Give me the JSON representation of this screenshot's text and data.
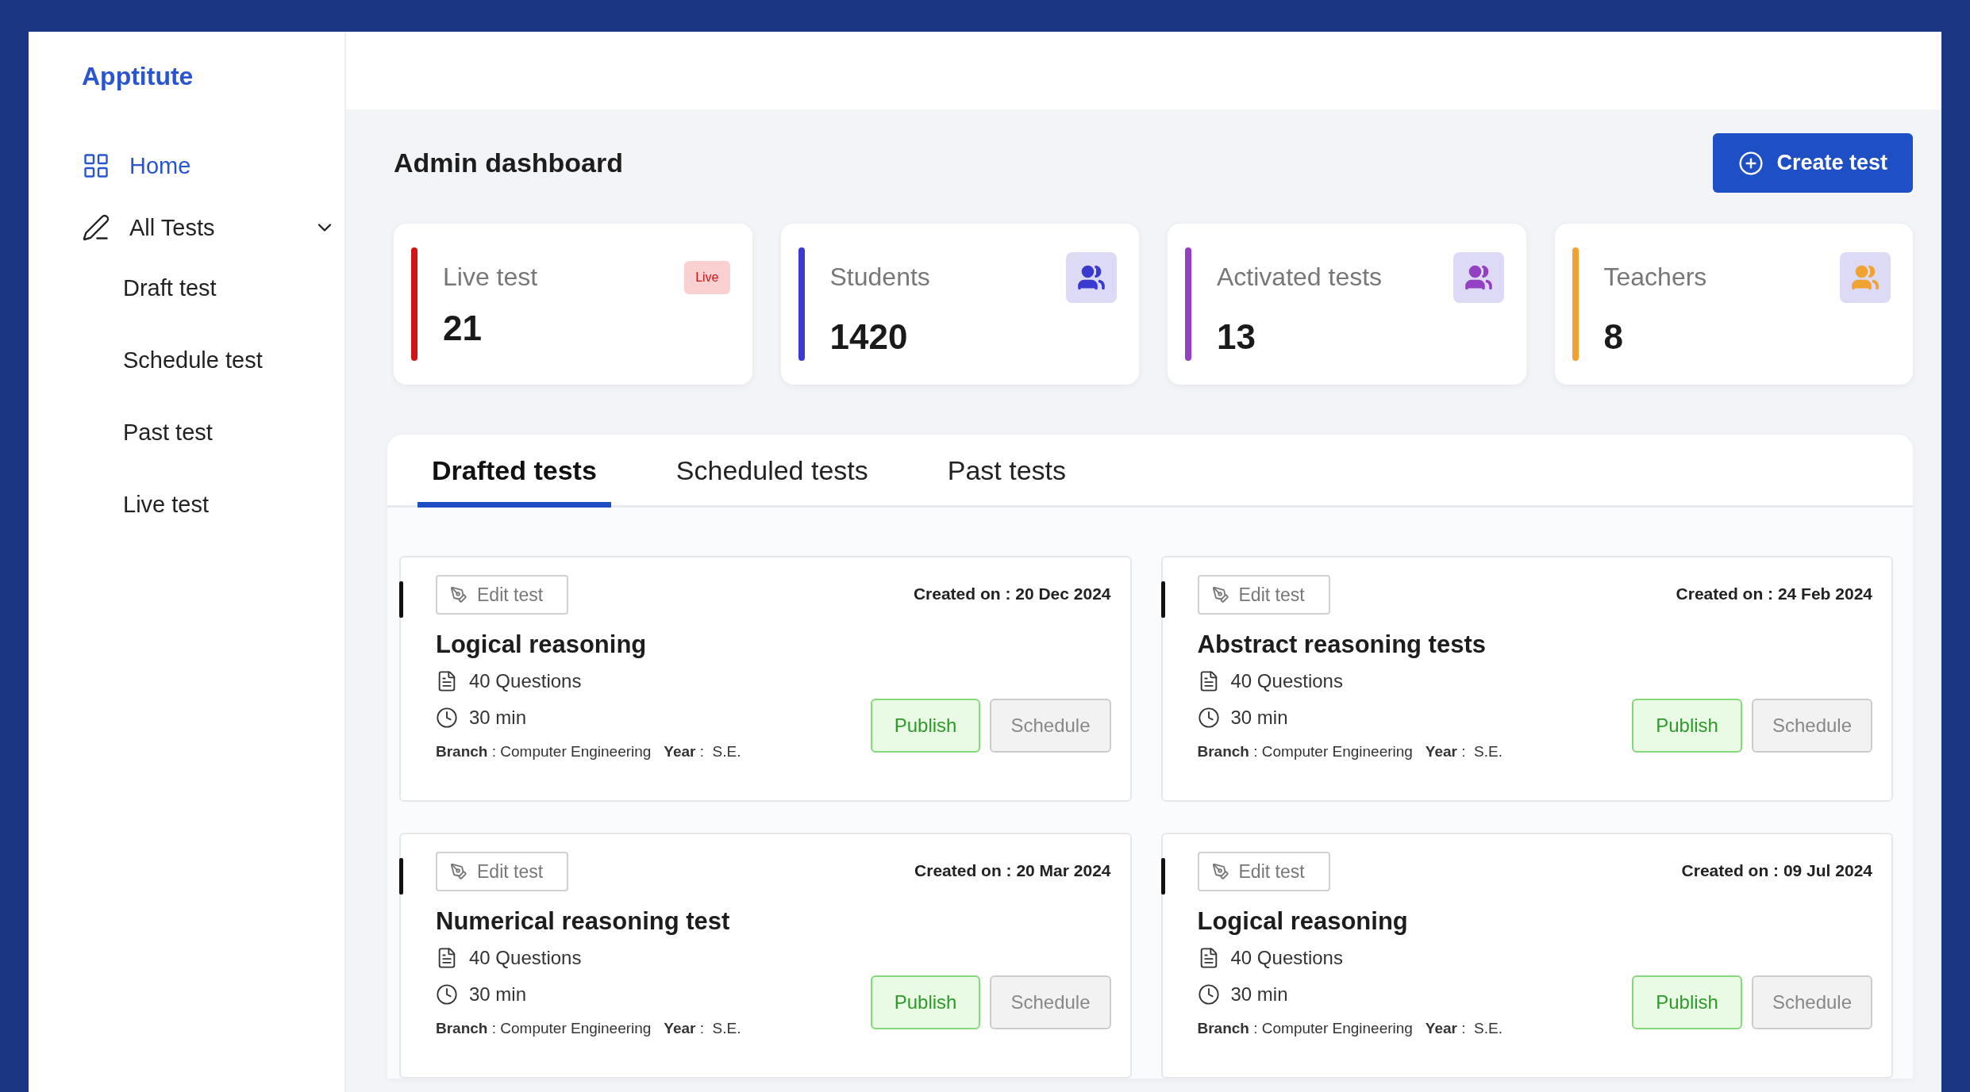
{
  "sidebar": {
    "logo": "Apptitute",
    "items": [
      {
        "label": "Home",
        "kind": "home",
        "selected": true
      },
      {
        "label": "All Tests",
        "kind": "tests",
        "selected": false,
        "expanded": true,
        "children": [
          {
            "label": "Draft test",
            "selected": false
          },
          {
            "label": "Schedule test",
            "selected": false
          },
          {
            "label": "Past test",
            "selected": false
          },
          {
            "label": "Live test",
            "selected": false
          }
        ]
      }
    ]
  },
  "header": {
    "title": "Admin dashboard",
    "create_button": "Create test"
  },
  "stats": [
    {
      "kind": "badge",
      "label": "Live test",
      "value": "21",
      "color": "#d21414",
      "badge": "Live"
    },
    {
      "kind": "people",
      "label": "Students",
      "value": "1420",
      "color": "#3a3ad0"
    },
    {
      "kind": "people",
      "label": "Activated tests",
      "value": "13",
      "color": "#9440c4"
    },
    {
      "kind": "people",
      "label": "Teachers",
      "value": "8",
      "color": "#f0a232"
    }
  ],
  "tabs": [
    {
      "label": "Drafted tests",
      "selected": true
    },
    {
      "label": "Scheduled tests",
      "selected": false
    },
    {
      "label": "Past tests",
      "selected": false
    }
  ],
  "tests": [
    {
      "edit": "Edit test",
      "created": "Created on : 20 Dec 2024",
      "title": "Logical reasoning",
      "questions": "40 Questions",
      "duration": "30 min",
      "details": "**Branch** : Computer Engineering   **Year** :  S.E.",
      "publish": "Publish",
      "schedule": "Schedule"
    },
    {
      "edit": "Edit test",
      "created": "Created on : 24 Feb 2024",
      "title": "Abstract reasoning tests",
      "questions": "40 Questions",
      "duration": "30 min",
      "details": "**Branch** : Computer Engineering   **Year** :  S.E.",
      "publish": "Publish",
      "schedule": "Schedule"
    },
    {
      "edit": "Edit test",
      "created": "Created on : 20 Mar 2024",
      "title": "Numerical reasoning test",
      "questions": "40 Questions",
      "duration": "30 min",
      "details": "**Branch** : Computer Engineering   **Year** :  S.E.",
      "publish": "Publish",
      "schedule": "Schedule"
    },
    {
      "edit": "Edit test",
      "created": "Created on : 09 Jul 2024",
      "title": "Logical reasoning",
      "questions": "40 Questions",
      "duration": "30 min",
      "details": "**Branch** : Computer Engineering   **Year** :  S.E.",
      "publish": "Publish",
      "schedule": "Schedule"
    }
  ]
}
